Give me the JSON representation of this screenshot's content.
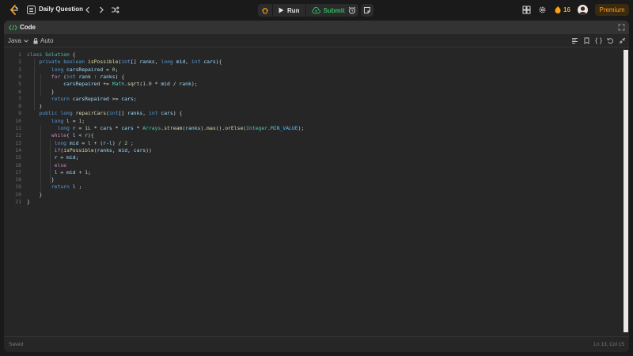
{
  "topbar": {
    "title": "Daily Question",
    "run_label": "Run",
    "submit_label": "Submit",
    "streak_count": "16",
    "premium_label": "Premium"
  },
  "panel": {
    "tab_label": "Code",
    "language": "Java",
    "auto_label": "Auto"
  },
  "status": {
    "saved": "Saved",
    "cursor": "Ln 13, Col 15"
  },
  "code": {
    "line_numbers": [
      "1",
      "2",
      "3",
      "4",
      "5",
      "6",
      "7",
      "8",
      "9",
      "10",
      "11",
      "12",
      "13",
      "14",
      "15",
      "16",
      "17",
      "18",
      "19",
      "20",
      "21"
    ],
    "lines": [
      "class Solution {",
      "    private boolean isPossible(int[] ranks, long mid, int cars){",
      "        long carsRepaired = 0;",
      "        for (int rank : ranks) {",
      "            carsRepaired += Math.sqrt(1.0 * mid / rank);",
      "        }",
      "        return carsRepaired >= cars;",
      "    }",
      "    public long repairCars(int[] ranks, int cars) {",
      "        long l = 1;",
      "          long r = 1L * cars * cars * Arrays.stream(ranks).max().orElse(Integer.MIN_VALUE);",
      "        while( l < r){",
      "         long mid = l + (r-l) / 2 ;",
      "         if(isPossible(ranks, mid, cars))",
      "         r = mid;",
      "         else",
      "         l = mid + 1;",
      "        }",
      "        return l ;",
      "    }",
      "}"
    ]
  },
  "colors": {
    "keyword": "#569cd6",
    "type": "#4ec9b0",
    "function": "#dcdcaa",
    "submit": "#2cbb5d",
    "brand": "#ffa116"
  }
}
